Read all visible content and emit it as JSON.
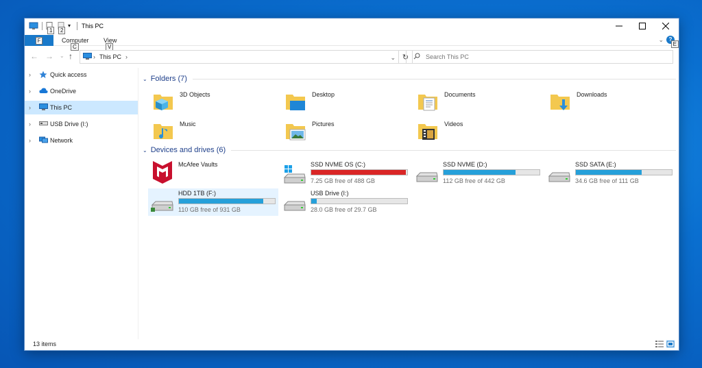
{
  "window": {
    "title": "This PC",
    "key_tips": {
      "qa1": "1",
      "qa2": "2",
      "file": "F",
      "computer": "C",
      "view": "V",
      "help": "E"
    }
  },
  "ribbon": {
    "tabs": [
      {
        "label": "Computer"
      },
      {
        "label": "View"
      }
    ]
  },
  "address": {
    "crumbs": [
      "This PC"
    ]
  },
  "search": {
    "placeholder": "Search This PC"
  },
  "sidebar": {
    "items": [
      {
        "label": "Quick access",
        "icon": "star-icon"
      },
      {
        "label": "OneDrive",
        "icon": "cloud-icon"
      },
      {
        "label": "This PC",
        "icon": "computer-icon",
        "selected": true
      },
      {
        "label": "USB Drive (I:)",
        "icon": "usb-drive-icon"
      },
      {
        "label": "Network",
        "icon": "network-icon"
      }
    ]
  },
  "folders": {
    "header": "Folders (7)",
    "items": [
      {
        "label": "3D Objects",
        "icon": "3d-objects-folder-icon"
      },
      {
        "label": "Desktop",
        "icon": "desktop-folder-icon"
      },
      {
        "label": "Documents",
        "icon": "documents-folder-icon"
      },
      {
        "label": "Downloads",
        "icon": "downloads-folder-icon"
      },
      {
        "label": "Music",
        "icon": "music-folder-icon"
      },
      {
        "label": "Pictures",
        "icon": "pictures-folder-icon"
      },
      {
        "label": "Videos",
        "icon": "videos-folder-icon"
      }
    ]
  },
  "drives": {
    "header": "Devices and drives (6)",
    "items": [
      {
        "name": "McAfee Vaults",
        "icon": "mcafee-icon",
        "has_bar": false
      },
      {
        "name": "SSD NVME OS (C:)",
        "free": "7.25 GB free of 488 GB",
        "used_fraction": 0.985,
        "critical": true,
        "icon": "windows-drive-icon"
      },
      {
        "name": "SSD NVME (D:)",
        "free": "112 GB free of 442 GB",
        "used_fraction": 0.747,
        "critical": false,
        "icon": "hard-drive-icon"
      },
      {
        "name": "SSD SATA (E:)",
        "free": "34.6 GB free of 111 GB",
        "used_fraction": 0.688,
        "critical": false,
        "icon": "hard-drive-icon"
      },
      {
        "name": "HDD 1TB (F:)",
        "free": "110 GB free of 931 GB",
        "used_fraction": 0.882,
        "critical": false,
        "icon": "hard-drive-icon",
        "selected": true
      },
      {
        "name": "USB Drive (I:)",
        "free": "28.0 GB free of 29.7 GB",
        "used_fraction": 0.057,
        "critical": false,
        "icon": "usb-drive-icon"
      }
    ]
  },
  "status": {
    "count": "13 items"
  },
  "colors": {
    "accent": "#1979ca",
    "bar": "#26a0da",
    "bar_critical": "#da2626",
    "selection": "#cce8ff",
    "group_title": "#1e3f8a"
  }
}
